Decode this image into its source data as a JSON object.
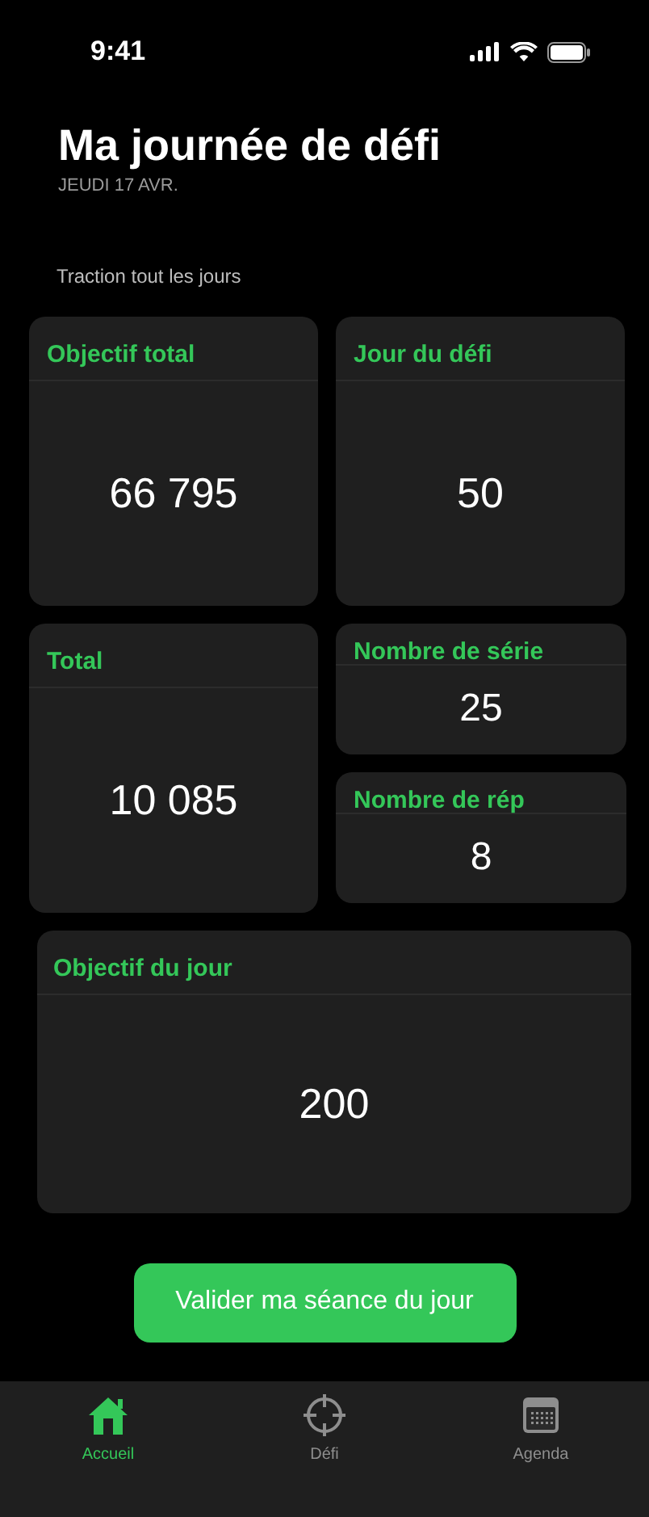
{
  "status_bar": {
    "time": "9:41"
  },
  "header": {
    "title": "Ma journée de défi",
    "date": "JEUDI 17 AVR."
  },
  "challenge_name": "Traction tout les jours",
  "cards": [
    {
      "kind": "large",
      "label": "Objectif total",
      "value": "66 795"
    },
    {
      "kind": "large",
      "label": "Jour du défi",
      "value": "50"
    },
    {
      "kind": "large",
      "label": "Total",
      "value": "10 085"
    },
    {
      "kind": "compact",
      "label": "Nombre de série",
      "value": "25"
    },
    {
      "kind": "compact",
      "label": "Nombre de rép",
      "value": "8"
    },
    {
      "kind": "wide",
      "label": "Objectif du jour",
      "value": "200"
    }
  ],
  "action_button": "Valider ma séance du jour",
  "tabs": [
    {
      "label": "Accueil",
      "selected": true,
      "kind": "home"
    },
    {
      "label": "Défi",
      "selected": false,
      "kind": "target"
    },
    {
      "label": "Agenda",
      "selected": false,
      "kind": "calendar"
    }
  ]
}
